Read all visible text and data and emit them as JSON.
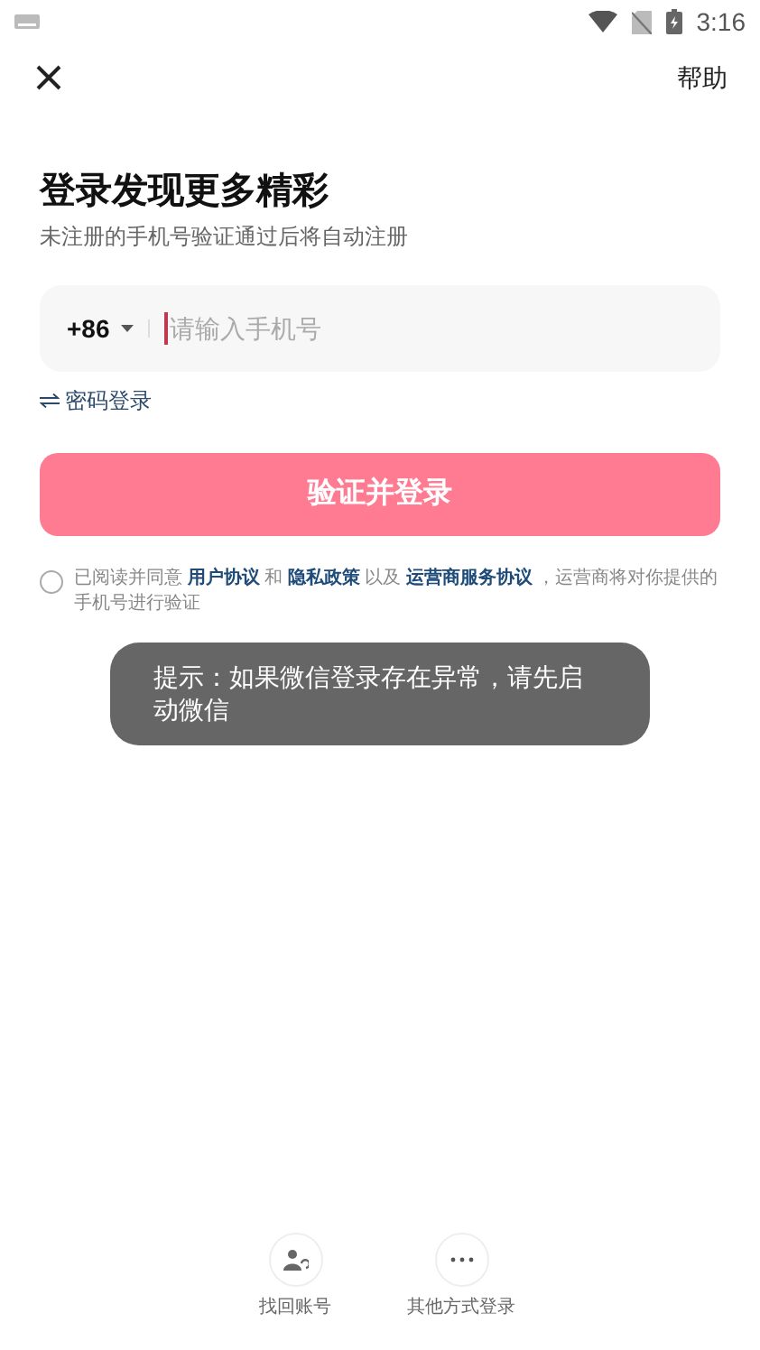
{
  "status_bar": {
    "time": "3:16"
  },
  "header": {
    "help": "帮助"
  },
  "title": "登录发现更多精彩",
  "subtitle": "未注册的手机号验证通过后将自动注册",
  "phone_field": {
    "country_code": "+86",
    "placeholder": "请输入手机号"
  },
  "password_login": "密码登录",
  "submit_button": {
    "label": "验证并登录",
    "disabled": true
  },
  "agreement": {
    "checked": false,
    "parts": [
      {
        "kind": "text",
        "text": "已阅读并同意 "
      },
      {
        "kind": "link",
        "text": "用户协议"
      },
      {
        "kind": "text",
        "text": " 和 "
      },
      {
        "kind": "link",
        "text": "隐私政策"
      },
      {
        "kind": "text",
        "text": " 以及 "
      },
      {
        "kind": "link",
        "text": "运营商服务协议"
      },
      {
        "kind": "text",
        "text": " ，运营商将对你提供的手机号进行验证"
      }
    ]
  },
  "toast": "提示：如果微信登录存在异常，请先启动微信",
  "bottom_actions": [
    {
      "kind": "account",
      "label": "找回账号"
    },
    {
      "kind": "more",
      "label": "其他方式登录"
    }
  ]
}
